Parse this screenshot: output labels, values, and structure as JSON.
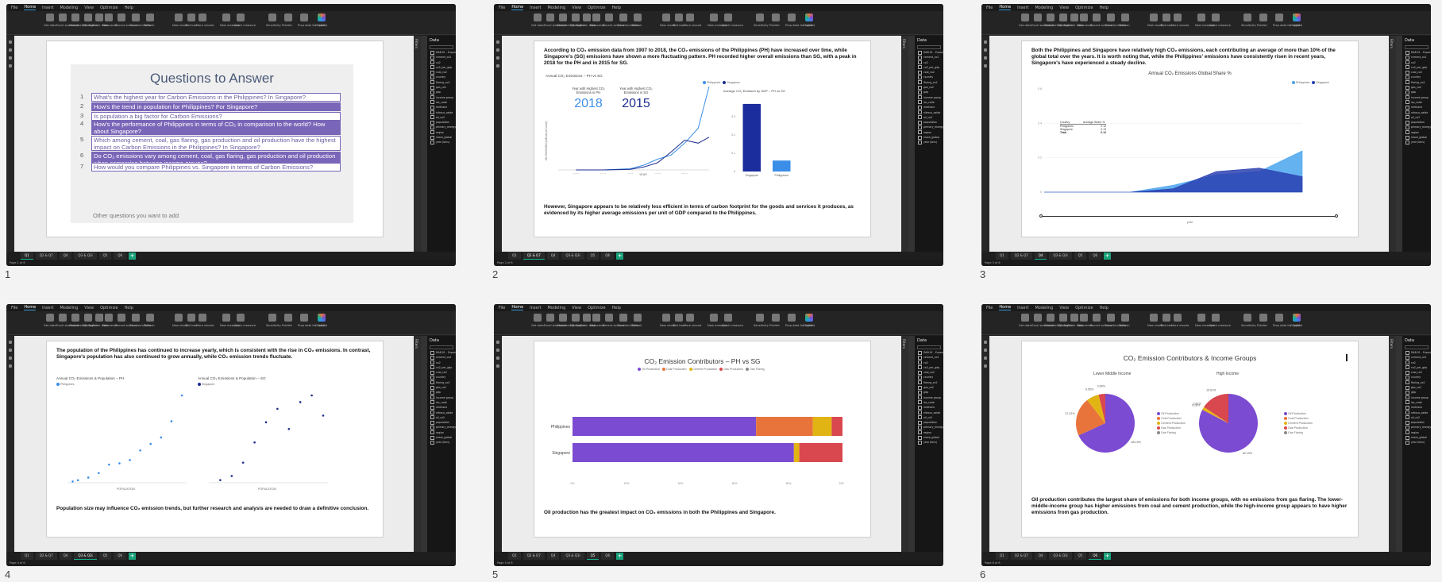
{
  "app": {
    "menu": [
      "File",
      "Home",
      "Insert",
      "Modeling",
      "View",
      "Optimize",
      "Help"
    ],
    "ribbon_buttons": [
      "Get data",
      "Excel workbook",
      "OneLake catalog",
      "SQL Server",
      "Enter data",
      "Dataverse",
      "Recent sources",
      "Transform data",
      "Refresh",
      "New visual",
      "Text box",
      "More visuals",
      "New measure",
      "Quick measure",
      "Sensitivity",
      "Publish",
      "Prep data for Copilot",
      "Copilot"
    ],
    "ribbon_sections": [
      "Clipboard",
      "Data",
      "Queries",
      "Insert",
      "Calculations",
      "Sensitivity",
      "Share",
      "Copilot"
    ],
    "filters_label": "Filters",
    "data_pane_title": "Data",
    "table_name": "DAB.01 - Expanded",
    "fields": [
      "cement_co2",
      "co2",
      "co2_per_gdp",
      "coal_co2",
      "country",
      "flaring_co2",
      "gas_co2",
      "gdp",
      "income group",
      "iso_code",
      "methane",
      "nitrous_oxide",
      "oil_co2",
      "population",
      "primary_energy",
      "region",
      "share_global",
      "year (bins)"
    ],
    "page_tabs": [
      "Q1",
      "Q2 & Q7",
      "Q4",
      "Q3 & Q3i",
      "Q5",
      "Q6"
    ],
    "add_page": "+"
  },
  "captions": [
    "1",
    "2",
    "3",
    "4",
    "5",
    "6"
  ],
  "slides": [
    {
      "status": "Page 1 of 6",
      "active_tab": "Q1",
      "title": "Questions to Answer",
      "questions": [
        {
          "n": "1",
          "text": "What's the highest year for Carbon Emissions in the Philippines? In Singapore?"
        },
        {
          "n": "2",
          "text": "How's the trend in population for Philippines? For Singapore?"
        },
        {
          "n": "3",
          "text": "Is population a big factor for Carbon Emissions?"
        },
        {
          "n": "4",
          "text": "How's the performance of Philippines in terms of CO₂ in comparison to the world? How about Singapore?"
        },
        {
          "n": "5",
          "text": "Which among cement, coal, gas flaring, gas production and oil production have the highest impact on Carbon Emissions in the Philippines? In Singapore?"
        },
        {
          "n": "6",
          "text": "Do CO₂ emissions vary among cement, coal, gas flaring, gas production and oil production when comparing between income groups?"
        },
        {
          "n": "7",
          "text": "How would you compare Philippines vs. Singapore in terms of Carbon Emissions?"
        }
      ],
      "other": "Other questions you want to add"
    },
    {
      "status": "Page 2 of 6",
      "active_tab": "Q2 & Q7",
      "intro": "According to CO₂ emission data from 1907 to 2018, the CO₂ emissions of the Philippines (PH) have increased over time, while Singapore's (SG) emissions have shown a more fluctuating pattern. PH recorded higher overall emissions than SG, with a peak in 2018 for the PH and in 2015 for SG.",
      "chart_title": "Annual CO₂ Emissions – PH vs SG",
      "card1_label": "Year with Highest CO₂ Emissions in PH",
      "card1_value": "2018",
      "card2_label": "Year with Highest CO₂ Emissions in SG",
      "card2_value": "2015",
      "legend": [
        "Philippines",
        "Singapore"
      ],
      "ylabel": "OIL EMISSION (millions per tonne)",
      "xlabel": "YEAR",
      "bar_title": "Average CO₂ Emission by GDP – PH vs SG",
      "bar_ylabel": "CO₂ EMISSION PER UNIT OF GDP",
      "outro": "However, Singapore appears to be relatively less efficient in terms of carbon footprint for the goods and services it produces, as evidenced by its higher average emissions per unit of GDP compared to the Philippines."
    },
    {
      "status": "Page 3 of 6",
      "active_tab": "Q4",
      "intro": "Both the Philippines and Singapore have relatively high CO₂ emissions, each contributing an average of more than 10% of the global total over the years. It is worth noting that, while the Philippines' emissions have consistently risen in recent years, Singapore's have experienced a steady decline.",
      "chart_title": "Annual CO₂ Emissions Global Share %",
      "legend": [
        "Philippines",
        "Singapore"
      ],
      "table_headers": [
        "Country",
        "Average Share %"
      ],
      "table_rows": [
        [
          "Philippines",
          "0.12"
        ],
        [
          "Singapore",
          "0.13"
        ],
        [
          "Total",
          "0.13"
        ]
      ],
      "xlabel": "year"
    },
    {
      "status": "Page 4 of 6",
      "active_tab": "Q3 & Q3i",
      "intro": "The population of the Philippines has continued to increase yearly, which is consistent with the rise in CO₂ emissions. In contrast, Singapore's population has also continued to grow annually, while CO₂ emission trends fluctuate.",
      "left_title": "Annual CO₂ Emissions & Population – PH",
      "left_legend": "Philippines",
      "right_title": "Annual CO₂ Emissions & Population – SG",
      "right_legend": "Singapore",
      "ylabel": "CO2 EMISSION (millions per tonne)",
      "xlabel": "POPULATION",
      "outro": "Population size may influence CO₂ emission trends, but further research and analysis are needed to draw a definitive conclusion."
    },
    {
      "status": "Page 5 of 6",
      "active_tab": "Q5",
      "chart_title": "CO₂ Emission Contributors – PH vs SG",
      "legend": [
        "Oil Production",
        "Coal Production",
        "Cement Production",
        "Gas Production",
        "Gas Flaring"
      ],
      "outro": "Oil production has the greatest impact on CO₂ emissions in both the Philippines and Singapore."
    },
    {
      "status": "Page 6 of 6",
      "active_tab": "Q6",
      "chart_title": "CO₂ Emission Contributors & Income Groups",
      "left_title": "Lower Middle Income",
      "right_title": "High Income",
      "legend": [
        "Oil Production",
        "Coal Production",
        "Cement Production",
        "Gas Production",
        "Gas Flaring"
      ],
      "outro": "Oil production contributes the largest share of emissions for both income groups, with no emissions from gas flaring. The lower-middle-income group has higher emissions from coal and cement production, while the high-income group appears to have higher emissions from gas production."
    }
  ],
  "chart_data": [
    {
      "type": "line",
      "title": "Annual CO₂ Emissions – PH vs SG",
      "xlabel": "YEAR",
      "ylabel": "OIL EMISSION (millions per tonne)",
      "x": [
        1920,
        1940,
        1960,
        1970,
        1980,
        1990,
        2000,
        2010,
        2018
      ],
      "series": [
        {
          "name": "Philippines",
          "values": [
            0,
            0,
            2,
            8,
            18,
            25,
            45,
            70,
            140
          ],
          "color": "#3b8ee8"
        },
        {
          "name": "Singapore",
          "values": [
            0,
            0,
            1,
            5,
            12,
            30,
            50,
            45,
            55
          ],
          "color": "#1b2c8c"
        }
      ],
      "xlim": [
        1907,
        2018
      ]
    },
    {
      "type": "bar",
      "title": "Average CO₂ Emission by GDP – PH vs SG",
      "categories": [
        "Singapore",
        "Philippines"
      ],
      "values": [
        0.37,
        0.06
      ],
      "ylim": [
        0,
        0.4
      ],
      "colors": [
        "#1b2c9c",
        "#3b8ee8"
      ]
    },
    {
      "type": "area",
      "title": "Annual CO₂ Emissions Global Share %",
      "xlabel": "year",
      "x": [
        1900,
        1920,
        1940,
        1960,
        1980,
        2000,
        2020
      ],
      "series": [
        {
          "name": "Philippines",
          "values": [
            0,
            0,
            0,
            0.04,
            0.1,
            0.12,
            0.24
          ],
          "color": "#4aa4ef"
        },
        {
          "name": "Singapore",
          "values": [
            0,
            0,
            0,
            0.02,
            0.12,
            0.14,
            0.09
          ],
          "color": "#2a3fb0"
        }
      ],
      "ylim": [
        0,
        0.6
      ]
    },
    {
      "type": "scatter",
      "title": "Annual CO₂ Emissions & Population – PH",
      "xlabel": "POPULATION",
      "series": [
        {
          "name": "Philippines",
          "points": [
            [
              5,
              2
            ],
            [
              10,
              4
            ],
            [
              20,
              8
            ],
            [
              30,
              15
            ],
            [
              40,
              28
            ],
            [
              50,
              30
            ],
            [
              60,
              35
            ],
            [
              70,
              50
            ],
            [
              80,
              60
            ],
            [
              90,
              70
            ],
            [
              100,
              95
            ],
            [
              110,
              135
            ]
          ],
          "color": "#3b8ee8"
        }
      ]
    },
    {
      "type": "scatter",
      "title": "Annual CO₂ Emissions & Population – SG",
      "xlabel": "POPULATION",
      "series": [
        {
          "name": "Singapore",
          "points": [
            [
              1,
              2
            ],
            [
              2,
              5
            ],
            [
              3,
              15
            ],
            [
              4,
              30
            ],
            [
              5,
              45
            ],
            [
              6,
              55
            ],
            [
              7,
              40
            ],
            [
              8,
              60
            ],
            [
              9,
              65
            ],
            [
              10,
              50
            ]
          ],
          "color": "#1b2c8c"
        }
      ]
    },
    {
      "type": "bar",
      "title": "CO₂ Emission Contributors – PH vs SG",
      "categories": [
        "Philippines",
        "Singapore"
      ],
      "series": [
        {
          "name": "Oil Production",
          "values": [
            68,
            82
          ],
          "color": "#7b4bd1"
        },
        {
          "name": "Coal Production",
          "values": [
            21,
            0
          ],
          "color": "#e8743b"
        },
        {
          "name": "Cement Production",
          "values": [
            7,
            2
          ],
          "color": "#e1b414"
        },
        {
          "name": "Gas Production",
          "values": [
            4,
            16
          ],
          "color": "#d9474f"
        },
        {
          "name": "Gas Flaring",
          "values": [
            0,
            0
          ],
          "color": "#8a8a8a"
        }
      ],
      "xlim": [
        0,
        100
      ]
    },
    {
      "type": "pie",
      "title": "Lower Middle Income",
      "labels": [
        "Oil Production",
        "Coal Production",
        "Cement Production",
        "Gas Production",
        "Gas Flaring"
      ],
      "values": [
        68.19,
        21.22,
        6.95,
        3.64,
        0
      ],
      "data_labels": [
        "68.19%",
        "21.22%",
        "6.95%",
        "3.64%"
      ]
    },
    {
      "type": "pie",
      "title": "High Income",
      "labels": [
        "Oil Production",
        "Coal Production",
        "Cement Production",
        "Gas Production",
        "Gas Flaring"
      ],
      "values": [
        82.19,
        0.28,
        1.5,
        15.61,
        0
      ],
      "data_labels": [
        "82.19%",
        "0.28%",
        "3.41%",
        "15.61%"
      ]
    }
  ]
}
